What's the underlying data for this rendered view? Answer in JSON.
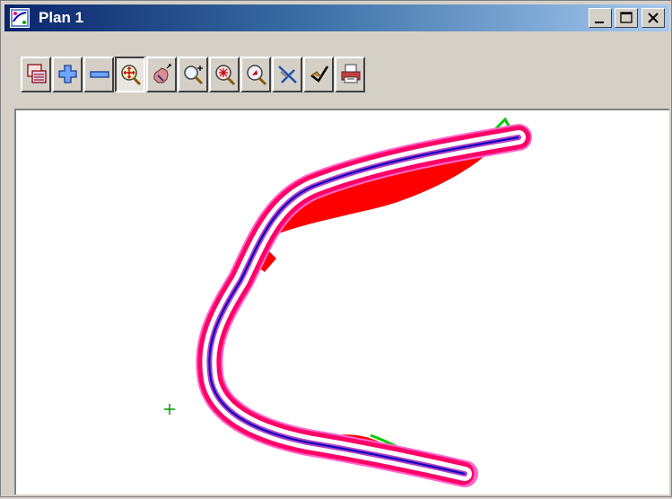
{
  "window": {
    "title": "Plan 1",
    "controls": [
      {
        "name": "minimize-button",
        "icon": "minimize-icon"
      },
      {
        "name": "maximize-button",
        "icon": "maximize-icon"
      },
      {
        "name": "close-button",
        "icon": "close-icon"
      }
    ]
  },
  "toolbar": {
    "buttons": [
      {
        "name": "plot-button",
        "icon": "plot-layers-icon"
      },
      {
        "name": "zoom-in-button",
        "icon": "plus-icon"
      },
      {
        "name": "zoom-out-button",
        "icon": "minus-icon"
      },
      {
        "name": "fit-button",
        "icon": "fit-zoom-icon",
        "pressed": true
      },
      {
        "name": "pan-button",
        "icon": "hand-pan-icon"
      },
      {
        "name": "zoom-window-button",
        "icon": "zoom-window-icon"
      },
      {
        "name": "zoom-extent-button",
        "icon": "zoom-extent-icon"
      },
      {
        "name": "pick-button",
        "icon": "pick-icon"
      },
      {
        "name": "clear-button",
        "icon": "clear-icon"
      },
      {
        "name": "tracking-button",
        "icon": "tracking-icon"
      },
      {
        "name": "print-button",
        "icon": "printer-icon"
      }
    ]
  },
  "colors": {
    "road_centerline": "#0000c8",
    "road_pavement": "#ff66cc",
    "road_edge": "#ff0066",
    "cut_fill": "#ff0000",
    "batter": "#00cc00",
    "marker": "#009900"
  }
}
